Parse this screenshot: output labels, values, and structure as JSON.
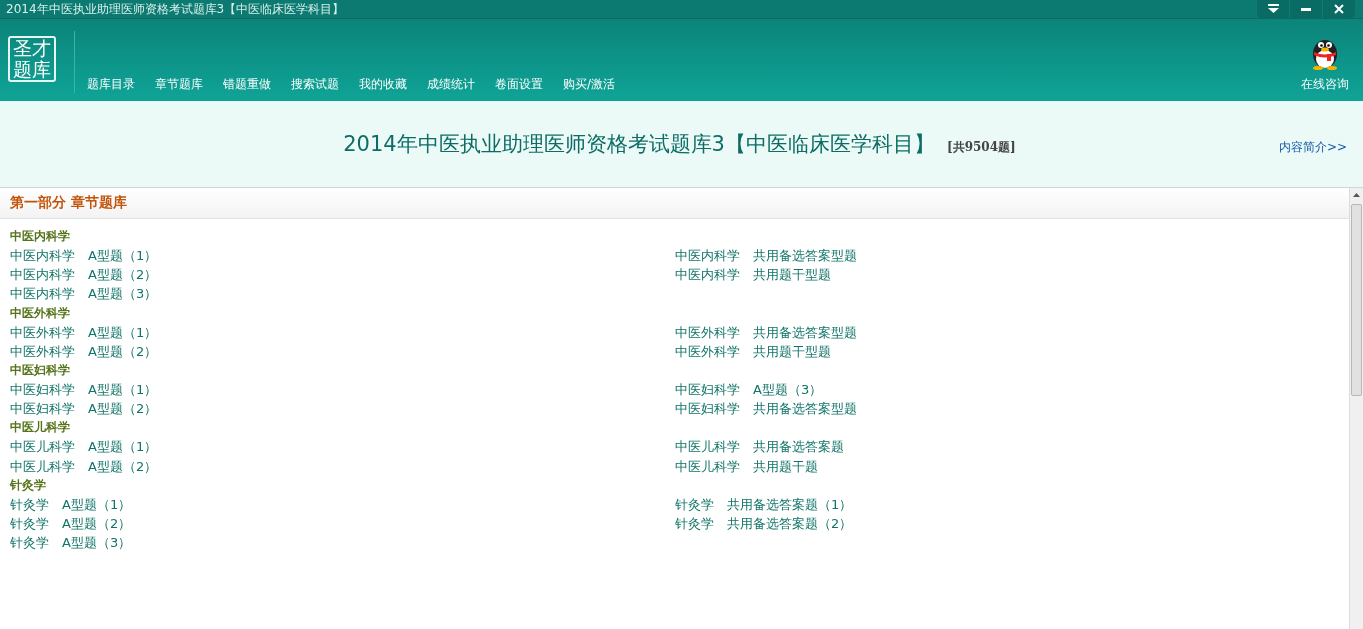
{
  "window": {
    "title": "2014年中医执业助理医师资格考试题库3【中医临床医学科目】"
  },
  "logo": {
    "lines": [
      "圣才",
      "题库"
    ]
  },
  "nav": [
    {
      "label": "题库目录"
    },
    {
      "label": "章节题库"
    },
    {
      "label": "错题重做"
    },
    {
      "label": "搜索试题"
    },
    {
      "label": "我的收藏"
    },
    {
      "label": "成绩统计"
    },
    {
      "label": "卷面设置"
    },
    {
      "label": "购买/激活"
    }
  ],
  "consult": {
    "label": "在线咨询"
  },
  "banner": {
    "title": "2014年中医执业助理医师资格考试题库3【中医临床医学科目】",
    "count": "[共9504题]",
    "intro_link": "内容简介>>"
  },
  "part": {
    "title": "第一部分 章节题库"
  },
  "sections": [
    {
      "title": "中医内科学",
      "left": [
        {
          "subject": "中医内科学",
          "type": "A型题（1）"
        },
        {
          "subject": "中医内科学",
          "type": "A型题（2）"
        },
        {
          "subject": "中医内科学",
          "type": "A型题（3）"
        }
      ],
      "right": [
        {
          "subject": "中医内科学",
          "type": "共用备选答案型题"
        },
        {
          "subject": "中医内科学",
          "type": "共用题干型题"
        }
      ]
    },
    {
      "title": "中医外科学",
      "left": [
        {
          "subject": "中医外科学",
          "type": "A型题（1）"
        },
        {
          "subject": "中医外科学",
          "type": "A型题（2）"
        }
      ],
      "right": [
        {
          "subject": "中医外科学",
          "type": "共用备选答案型题"
        },
        {
          "subject": "中医外科学",
          "type": "共用题干型题"
        }
      ]
    },
    {
      "title": "中医妇科学",
      "left": [
        {
          "subject": "中医妇科学",
          "type": "A型题（1）"
        },
        {
          "subject": "中医妇科学",
          "type": "A型题（2）"
        }
      ],
      "right": [
        {
          "subject": "中医妇科学",
          "type": "A型题（3）"
        },
        {
          "subject": "中医妇科学",
          "type": "共用备选答案型题"
        }
      ]
    },
    {
      "title": "中医儿科学",
      "left": [
        {
          "subject": "中医儿科学",
          "type": "A型题（1）"
        },
        {
          "subject": "中医儿科学",
          "type": "A型题（2）"
        }
      ],
      "right": [
        {
          "subject": "中医儿科学",
          "type": "共用备选答案题"
        },
        {
          "subject": "中医儿科学",
          "type": "共用题干题"
        }
      ]
    },
    {
      "title": "针灸学",
      "left": [
        {
          "subject": "针灸学",
          "type": "A型题（1）"
        },
        {
          "subject": "针灸学",
          "type": "A型题（2）"
        },
        {
          "subject": "针灸学",
          "type": "A型题（3）"
        }
      ],
      "right": [
        {
          "subject": "针灸学",
          "type": "共用备选答案题（1）"
        },
        {
          "subject": "针灸学",
          "type": "共用备选答案题（2）"
        }
      ]
    }
  ]
}
